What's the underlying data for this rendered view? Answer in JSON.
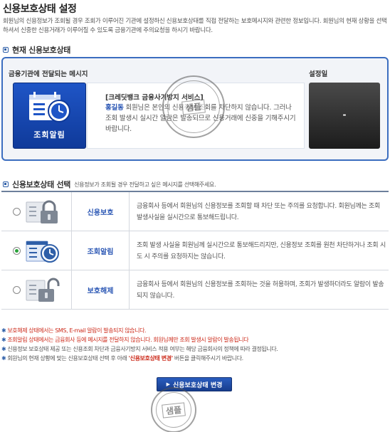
{
  "page": {
    "title": "신용보호상태 설정",
    "intro": "회원님의 신용정보가 조회될 경우 조회가 이루어진 기관에 설정하신 신용보호상태를 직접 전달하는 보호메시지와 관련한 정보입니다. 회원님의 현재 상황을 선택하셔서 신중한 신용거래가 이루어질 수 있도록 금융기관에 주의요청을 하시기 바랍니다."
  },
  "current": {
    "section_title": "현재 신용보호상태",
    "message_label": "금융기관에 전달되는 메시지",
    "date_label": "설정일",
    "tile_label": "조회알림",
    "tile_icon": "calendar-clock-icon",
    "msg_head": "[크레딧뱅크 금융사기방지 서비스]",
    "msg_name": "홍길동",
    "msg_body": " 회원님은 본인의 신용정보 조회를 차단하지 않습니다. 그러나 조회 발생시 실시간 알람은 발송되므로 신용거래에 신중을 기해주시기 바랍니다.",
    "date_value": "-",
    "stamp_text": "샘플"
  },
  "select": {
    "section_title": "신용보호상태 선택",
    "section_sub": "신용정보가 조회될 경우 전달하고 싶은 메시지를 선택해주세요.",
    "options": [
      {
        "name": "신용보호",
        "icon": "locked-padlock-icon",
        "selected": false,
        "desc": "금융회사 등에서 회원님의 신용정보를 조회할 때 차단 또는 주의를 요청합니다. 회원님께는 조회 발생사실을 실시간으로 통보해드립니다."
      },
      {
        "name": "조회알림",
        "icon": "calendar-clock-icon",
        "selected": true,
        "desc": "조회 발생 사실을 회원님께 실시간으로 통보해드리지만, 신용정보 조회를 원천 차단하거나 조회 시도 시 주의를 요청하지는 않습니다."
      },
      {
        "name": "보호해제",
        "icon": "unlocked-padlock-icon",
        "selected": false,
        "desc": "금융회사 등에서 회원님의 신용정보를 조회하는 것을 허용하며, 조회가 발생하더라도 알람이 발송되지 않습니다."
      }
    ]
  },
  "notes": {
    "n1": "보호해제 상태에서는 SMS, E-mail 알람이 발송되지 않습니다.",
    "n2": "조회알림 상태에서는 금융회사 등에 메시지를 전달하지 않습니다. 회원님께만 조회 발생시 알람이 발송됩니다",
    "n3": "신용정보 보호상태 제공 또는 신용조회 차단과 금융사기방지 서비스 적용 여부는 해당 금융회사의 정책에 따라 결정됩니다.",
    "n4_pre": "회원님의 현재 상황에 맞는 신용보호상태 선택 후 아래 ",
    "n4_hl": "'신용보호상태 변경'",
    "n4_post": " 버튼을 클릭해주시기 바랍니다."
  },
  "button": {
    "change_label": "신용보호상태 변경",
    "stamp_text": "샘플"
  },
  "colors": {
    "accent": "#2f5fa8",
    "tile_blue": "#1f55c6",
    "warning_red": "#cc2a1a",
    "selected_green": "#2aa23a"
  }
}
